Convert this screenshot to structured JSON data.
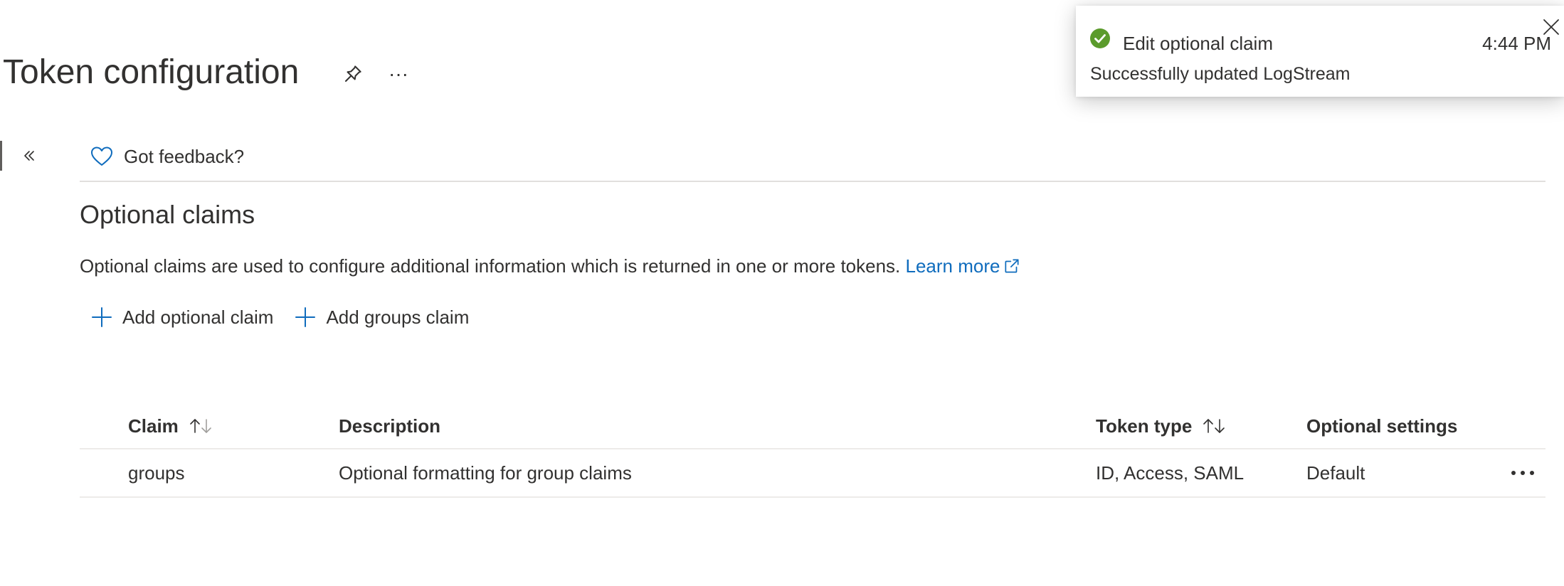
{
  "header": {
    "title": "Token configuration",
    "more_label": "···"
  },
  "feedback": {
    "label": "Got feedback?"
  },
  "section": {
    "title": "Optional claims",
    "description": "Optional claims are used to configure additional information which is returned in one or more tokens.",
    "learn_more": "Learn more"
  },
  "toolbar": {
    "add_optional_claim": "Add optional claim",
    "add_groups_claim": "Add groups claim"
  },
  "table": {
    "columns": {
      "claim": "Claim",
      "description": "Description",
      "token_type": "Token type",
      "optional_settings": "Optional settings"
    },
    "rows": [
      {
        "claim": "groups",
        "description": "Optional formatting for group claims",
        "token_type": "ID, Access, SAML",
        "optional_settings": "Default"
      }
    ]
  },
  "toast": {
    "title": "Edit optional claim",
    "time": "4:44 PM",
    "message": "Successfully updated LogStream"
  },
  "colors": {
    "accent": "#0f6cbd",
    "success": "#5b9b2c",
    "text": "#323130"
  },
  "icons": {
    "pin": "pin-icon",
    "more": "more-icon",
    "collapse": "double-chevron-left-icon",
    "feedback": "heart-icon",
    "external": "external-link-icon",
    "add": "plus-icon",
    "sort": "sort-icon",
    "success": "check-circle-icon",
    "close": "close-icon"
  }
}
